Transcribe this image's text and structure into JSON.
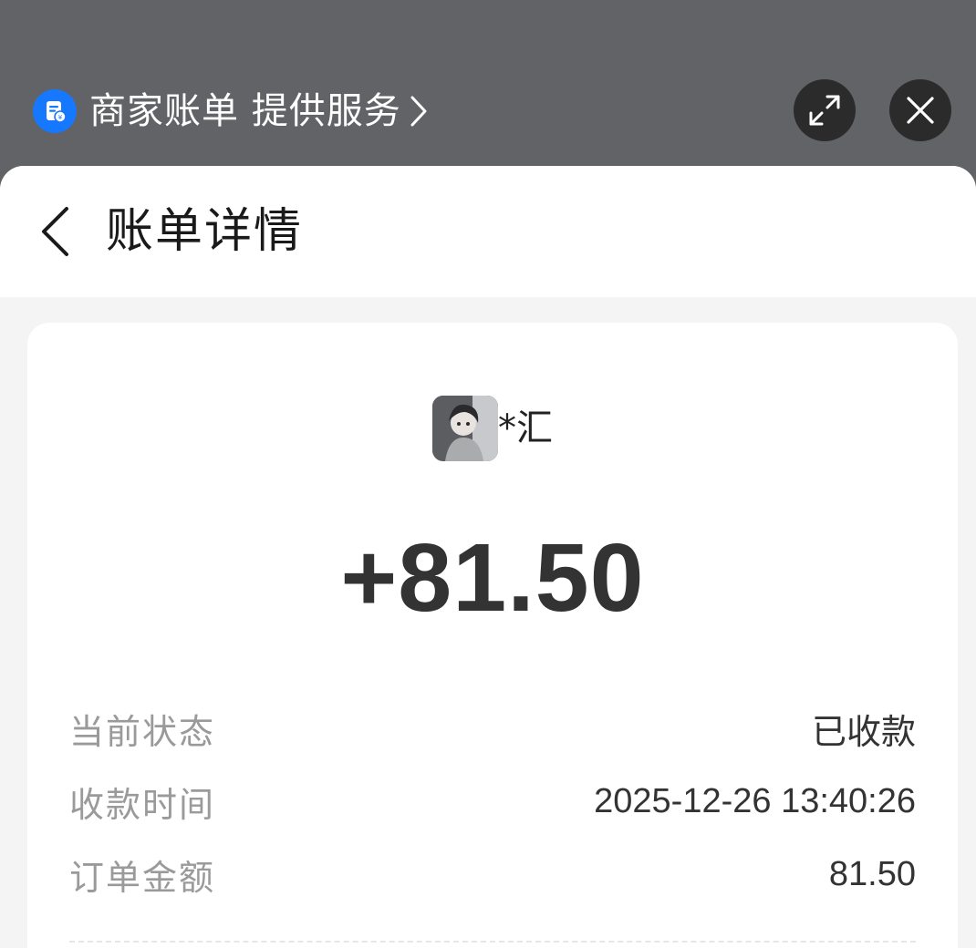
{
  "miniapp": {
    "provider_label": "商家账单 提供服务",
    "provider_icon": "bill-icon",
    "brand_color": "#1677ff",
    "expand_icon": "expand-icon",
    "close_icon": "close-icon"
  },
  "nav": {
    "back_icon": "chevron-left-icon",
    "title": "账单详情"
  },
  "bill": {
    "payer_name": "*汇",
    "amount": "+81.50",
    "rows": [
      {
        "label": "当前状态",
        "value": "已收款"
      },
      {
        "label": "收款时间",
        "value": "2025-12-26 13:40:26"
      },
      {
        "label": "订单金额",
        "value": "81.50"
      }
    ]
  }
}
